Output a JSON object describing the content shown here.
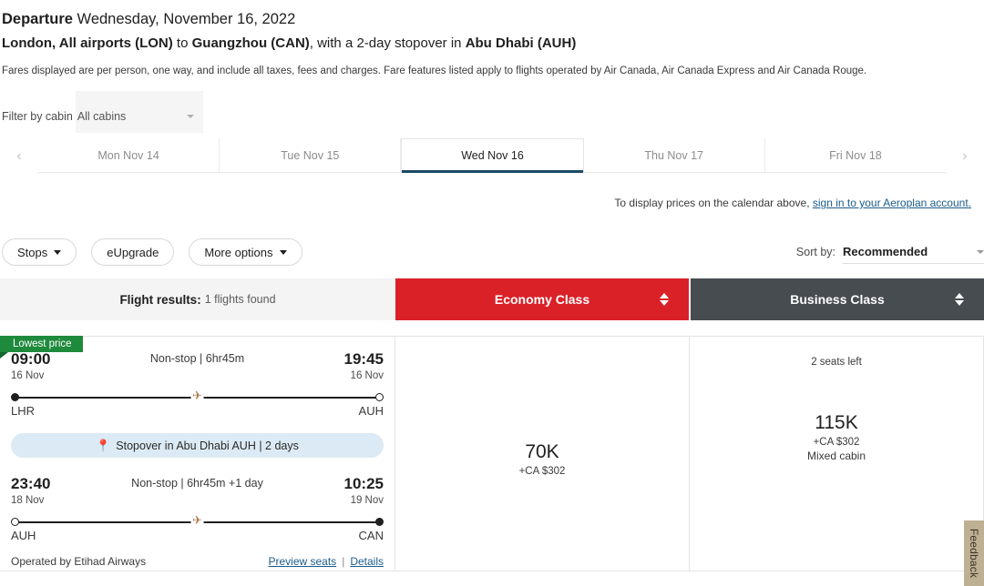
{
  "header": {
    "departure_label": "Departure",
    "departure_date": "Wednesday, November 16, 2022",
    "route_origin": "London, All airports (LON)",
    "route_connector_1": " to ",
    "route_destination": "Guangzhou (CAN)",
    "route_connector_2": ", with a 2-day stopover in ",
    "route_stopover": "Abu Dhabi (AUH)",
    "fares_note": "Fares displayed are per person, one way, and include all taxes, fees and charges. Fare features listed apply to flights operated by Air Canada, Air Canada Express and Air Canada Rouge."
  },
  "cabin_filter": {
    "label": "Filter by cabin",
    "selected": "All cabins"
  },
  "date_bar": {
    "prev_icon": "‹",
    "next_icon": "›",
    "tabs": [
      {
        "label": "Mon Nov 14",
        "active": false
      },
      {
        "label": "Tue Nov 15",
        "active": false
      },
      {
        "label": "Wed Nov 16",
        "active": true
      },
      {
        "label": "Thu Nov 17",
        "active": false
      },
      {
        "label": "Fri Nov 18",
        "active": false
      }
    ]
  },
  "aeroplan_note": {
    "text": "To display prices on the calendar above, ",
    "link": "sign in to your Aeroplan account."
  },
  "filters": {
    "stops_label": "Stops",
    "eupgrade_label": "eUpgrade",
    "more_options_label": "More options",
    "sort_by_label": "Sort by:",
    "sort_by_value": "Recommended"
  },
  "results_header": {
    "results_strong": "Flight results:",
    "results_count": "1 flights found",
    "economy_label": "Economy Class",
    "business_label": "Business Class"
  },
  "result": {
    "badge": "Lowest price",
    "legs": [
      {
        "depart_time": "09:00",
        "depart_date": "16 Nov",
        "middle": "Non-stop | 6hr45m",
        "arrive_time": "19:45",
        "arrive_date": "16 Nov",
        "origin_code": "LHR",
        "destination_code": "AUH"
      },
      {
        "depart_time": "23:40",
        "depart_date": "18 Nov",
        "middle": "Non-stop | 6hr45m +1 day",
        "arrive_time": "10:25",
        "arrive_date": "19 Nov",
        "origin_code": "AUH",
        "destination_code": "CAN"
      }
    ],
    "stopover": "Stopover in Abu Dhabi AUH | 2 days",
    "operated_by": "Operated by Etihad Airways",
    "preview_seats_link": "Preview seats",
    "link_separator": "|",
    "details_link": "Details",
    "economy": {
      "seats_left": "",
      "points": "70K",
      "cash": "+CA $302",
      "note": ""
    },
    "business": {
      "seats_left": "2 seats left",
      "points": "115K",
      "cash": "+CA $302",
      "note": "Mixed cabin"
    }
  },
  "feedback": {
    "label": "Feedback"
  },
  "colors": {
    "economy_header": "#da2128",
    "business_header": "#474c51",
    "lowest_price_badge": "#1e8a3c",
    "active_tab_underline": "#1b4a63",
    "stopover_pill": "#dbeaf4",
    "link": "#1a5b8a",
    "feedback_tab": "#beb093"
  }
}
